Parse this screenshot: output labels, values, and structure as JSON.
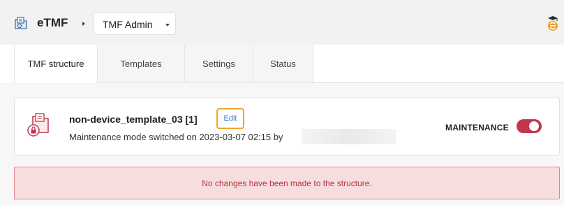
{
  "header": {
    "app_name": "eTMF",
    "workspace_selector": {
      "selected": "TMF Admin"
    },
    "icons": {
      "app": "etmf-folder-icon",
      "brand": "brand-logo-icon"
    }
  },
  "tabs": [
    {
      "label": "TMF structure",
      "active": true
    },
    {
      "label": "Templates",
      "active": false
    },
    {
      "label": "Settings",
      "active": false
    },
    {
      "label": "Status",
      "active": false
    }
  ],
  "template_card": {
    "title": "non-device_template_03 [1]",
    "edit_label": "Edit",
    "subtitle": "Maintenance mode switched on 2023-03-07 02:15 by",
    "maintenance_label": "MAINTENANCE",
    "maintenance_on": true,
    "icon": "locked-folder-icon"
  },
  "alert": {
    "message": "No changes have been made to the structure."
  },
  "colors": {
    "accent_red": "#c0384b",
    "edit_highlight": "#f2a628",
    "link_blue": "#3a7bd5",
    "alert_bg": "#f7dede",
    "alert_border": "#e4828e"
  }
}
